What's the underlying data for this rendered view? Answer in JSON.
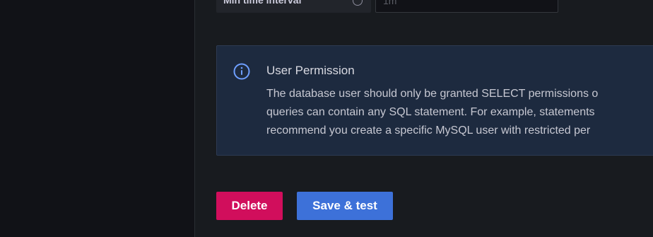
{
  "settings": {
    "min_time_interval": {
      "label": "Min time interval",
      "value": "",
      "placeholder": "1m"
    }
  },
  "alert": {
    "icon": "info-circle-icon",
    "title": "User Permission",
    "lines": [
      "The database user should only be granted SELECT permissions o",
      "queries can contain any SQL statement. For example, statements",
      "recommend you create a specific MySQL user with restricted per"
    ]
  },
  "actions": {
    "delete_label": "Delete",
    "save_label": "Save & test"
  },
  "colors": {
    "background": "#181b1f",
    "sidebar": "#111217",
    "alert_bg": "#1d2a3f",
    "alert_icon": "#6e9fff",
    "delete": "#d10e5c",
    "primary": "#3d71d9"
  }
}
